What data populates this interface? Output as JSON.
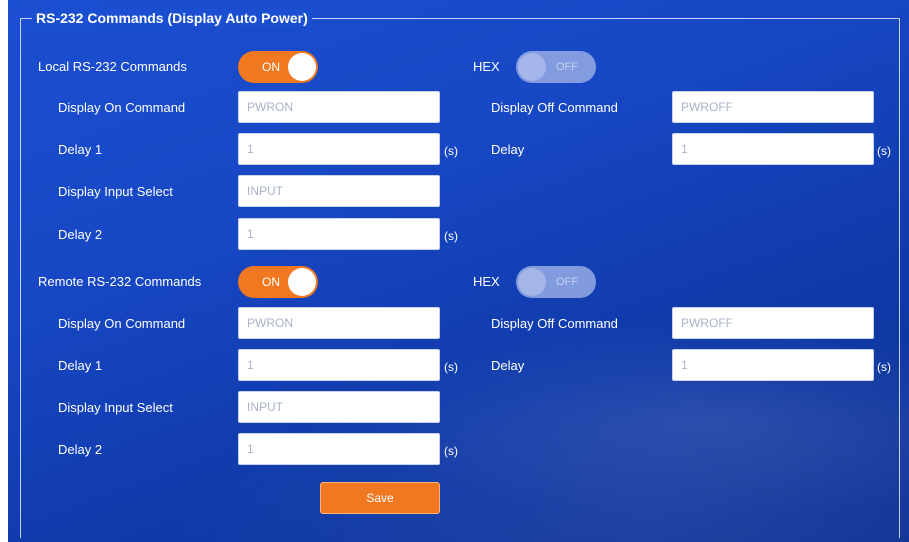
{
  "section_title": "RS-232 Commands (Display Auto Power)",
  "colors": {
    "accent": "#f07820",
    "background": "#1747c4",
    "toggle_off": "#8fa6e4"
  },
  "local": {
    "label": "Local RS-232 Commands",
    "toggle": "ON",
    "hex_label": "HEX",
    "hex_toggle": "OFF",
    "display_on_label": "Display On Command",
    "display_on_value": "PWRON",
    "delay1_label": "Delay 1",
    "delay1_value": "1",
    "input_select_label": "Display Input Select",
    "input_select_value": "INPUT",
    "delay2_label": "Delay 2",
    "delay2_value": "1",
    "display_off_label": "Display Off Command",
    "display_off_value": "PWROFF",
    "delay_label": "Delay",
    "delay_value": "1"
  },
  "remote": {
    "label": "Remote RS-232 Commands",
    "toggle": "ON",
    "hex_label": "HEX",
    "hex_toggle": "OFF",
    "display_on_label": "Display On Command",
    "display_on_value": "PWRON",
    "delay1_label": "Delay 1",
    "delay1_value": "1",
    "input_select_label": "Display Input Select",
    "input_select_value": "INPUT",
    "delay2_label": "Delay 2",
    "delay2_value": "1",
    "display_off_label": "Display Off Command",
    "display_off_value": "PWROFF",
    "delay_label": "Delay",
    "delay_value": "1"
  },
  "unit_seconds": "(s)",
  "save_label": "Save"
}
